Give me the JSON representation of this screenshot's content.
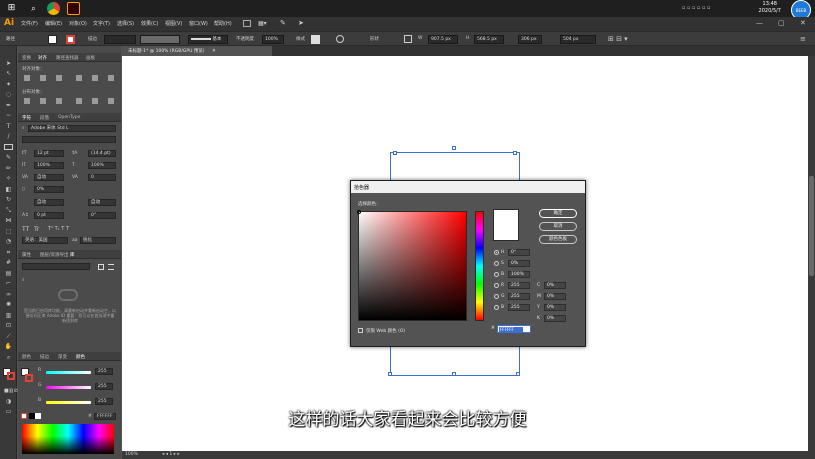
{
  "taskbar": {
    "time": "13:48",
    "date": "2020/5/7",
    "badge": "BEEB"
  },
  "app": {
    "logo": "Ai"
  },
  "menu": [
    "文件(F)",
    "编辑(E)",
    "对象(O)",
    "文字(T)",
    "选择(S)",
    "效果(C)",
    "视图(V)",
    "窗口(W)",
    "帮助(H)"
  ],
  "control": {
    "path_label": "路径",
    "stroke_label": "描边",
    "style_label": "基本",
    "opacity_label": "不透明度",
    "opacity": "100%",
    "style2_label": "样式",
    "shape_label": "形状",
    "w_label": "W",
    "w": "907.5 px",
    "h_label": "H",
    "h": "568.5 px",
    "x": "306 px",
    "y": "504 px"
  },
  "document": {
    "tab": "未标题-1* @ 100% (RGB/GPU 预览)",
    "zoom": "100%"
  },
  "panels": {
    "align_tabs": [
      "变换",
      "对齐",
      "路径查找器",
      "画板"
    ],
    "align_label": "对齐对象：",
    "distribute_label": "分布对象：",
    "char_tabs": [
      "字符",
      "段落",
      "OpenType"
    ],
    "font_name": "Adobe 宋体 Std L",
    "font_size": "12 pt",
    "leading": "(14.4 pt)",
    "scale_h": "100%",
    "scale_v": "100%",
    "kerning": "自动",
    "tracking": "0",
    "rotate": "0%",
    "auto1": "自动",
    "auto2": "自动",
    "baseline": "0 pt",
    "rotation": "0°",
    "tt1": "TT",
    "tt2": "Tr",
    "lang": "英语：美国",
    "aa": "锐化",
    "lib_tabs": [
      "属性",
      "图层/资源导出",
      "库"
    ],
    "cc_text": "您当前已启用库功能，请重新启动并重新启动它，以便访问正库 Adobe ID 重要：您可以在首选项中重新找到库",
    "color_tabs": [
      "颜色",
      "描边",
      "渐变",
      "颜色"
    ],
    "r": "255",
    "g": "255",
    "b": "255",
    "hex": "FFFFFF"
  },
  "picker": {
    "title": "拾色器",
    "select_label": "选择颜色：",
    "ok": "确定",
    "cancel": "取消",
    "swatches": "颜色色板",
    "web_only": "仅限 Web 颜色 (O)",
    "H_label": "H",
    "H": "0°",
    "S_label": "S",
    "S": "0%",
    "B_label": "B",
    "B": "100%",
    "R_label": "R",
    "R": "255",
    "G_label": "G",
    "G": "255",
    "Bv_label": "B",
    "Bv": "255",
    "C_label": "C",
    "C": "0%",
    "M_label": "M",
    "M": "0%",
    "Y_label": "Y",
    "Y": "0%",
    "K_label": "K",
    "K": "0%",
    "hex_label": "#",
    "hex": "FFFFFF"
  },
  "subtitle": "这样的话大家看起来会比较方便",
  "colors": {
    "accent": "#3b6fd6",
    "artboard": "#ffffff",
    "ui": "#535353"
  }
}
